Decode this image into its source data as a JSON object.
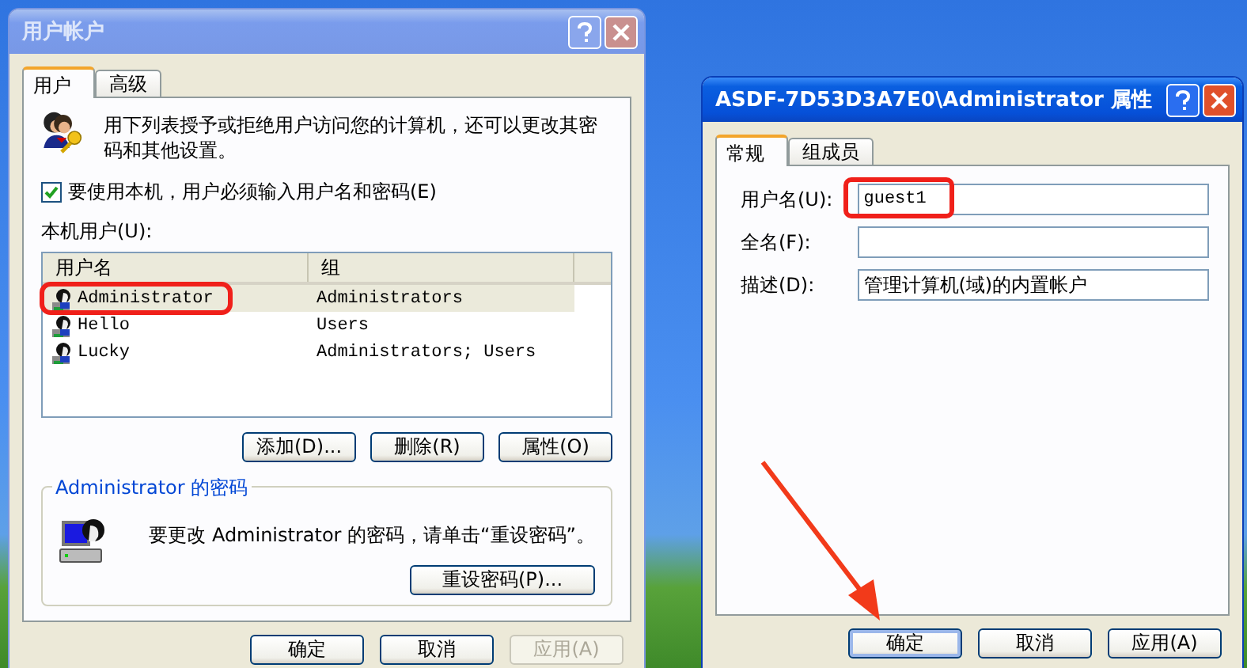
{
  "user_accounts_dialog": {
    "title": "用户帐户",
    "active": false,
    "tabs": [
      {
        "label": "用户",
        "selected": true
      },
      {
        "label": "高级",
        "selected": false
      }
    ],
    "intro": "用下列表授予或拒绝用户访问您的计算机，还可以更改其密码和其他设置。",
    "require_login": {
      "label": "要使用本机，用户必须输入用户名和密码(E)",
      "checked": true
    },
    "users_label": "本机用户(U):",
    "columns": [
      "用户名",
      "组"
    ],
    "users": [
      {
        "name": "Administrator",
        "group": "Administrators",
        "selected": true,
        "highlighted": true
      },
      {
        "name": "Hello",
        "group": "Users",
        "selected": false,
        "highlighted": false
      },
      {
        "name": "Lucky",
        "group": "Administrators; Users",
        "selected": false,
        "highlighted": false
      }
    ],
    "list_buttons": [
      "添加(D)...",
      "删除(R)",
      "属性(O)"
    ],
    "password_group": {
      "title": "Administrator 的密码",
      "message": "要更改 Administrator 的密码，请单击“重设密码”。",
      "button": "重设密码(P)..."
    },
    "footer_buttons": [
      {
        "label": "确定",
        "disabled": false
      },
      {
        "label": "取消",
        "disabled": false
      },
      {
        "label": "应用(A)",
        "disabled": true
      }
    ]
  },
  "properties_dialog": {
    "title": "ASDF-7D53D3A7E0\\Administrator 属性",
    "active": true,
    "tabs": [
      {
        "label": "常规",
        "selected": true
      },
      {
        "label": "组成员",
        "selected": false
      }
    ],
    "fields": [
      {
        "label": "用户名(U):",
        "value": "guest1",
        "highlighted": true
      },
      {
        "label": "全名(F):",
        "highlighted": false
      },
      {
        "label": "描述(D):",
        "value": "管理计算机(域)的内置帐户",
        "highlighted": false
      }
    ],
    "footer_buttons": [
      {
        "label": "确定",
        "disabled": false,
        "default": true
      },
      {
        "label": "取消",
        "disabled": false,
        "default": false
      },
      {
        "label": "应用(A)",
        "disabled": false,
        "default": false
      }
    ],
    "annotation_arrow": true
  }
}
